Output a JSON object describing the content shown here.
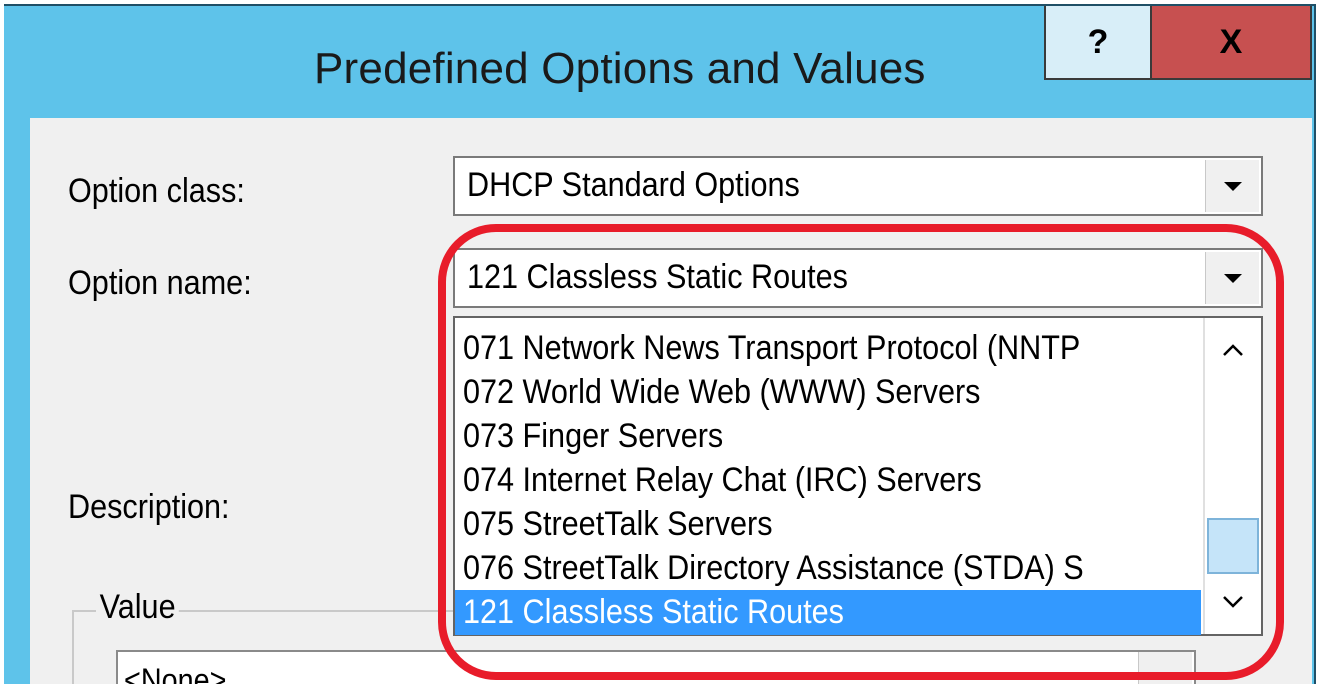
{
  "dialog": {
    "title": "Predefined Options and Values",
    "help_label": "?",
    "close_label": "X"
  },
  "form": {
    "option_class_label": "Option class:",
    "option_class_value": "DHCP Standard Options",
    "option_name_label": "Option name:",
    "option_name_value": "121 Classless Static Routes",
    "description_label": "Description:"
  },
  "dropdown": {
    "items": [
      "071 Network News Transport Protocol (NNTP",
      "072 World Wide Web (WWW) Servers",
      "073 Finger Servers",
      "074 Internet Relay Chat (IRC) Servers",
      "075 StreetTalk Servers",
      "076 StreetTalk Directory Assistance (STDA) S",
      "121 Classless Static Routes"
    ],
    "selected": "121 Classless Static Routes",
    "scroll_up": "^",
    "scroll_down": "v"
  },
  "value_group": {
    "label": "Value",
    "list_value": "<None>"
  },
  "colors": {
    "title_bar": "#5ec3ea",
    "close_button": "#c75050",
    "selection": "#3399ff",
    "highlight_ring": "#e81c2a"
  }
}
